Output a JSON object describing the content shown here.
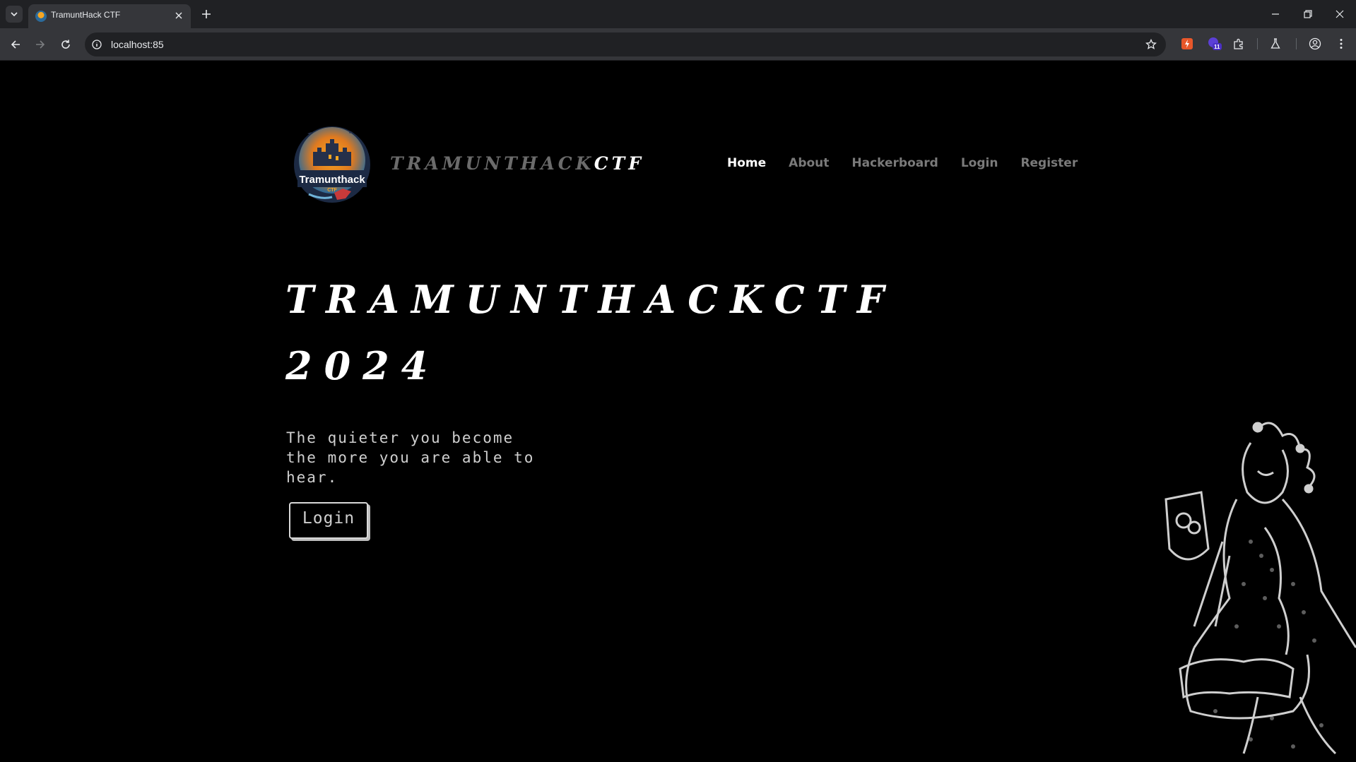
{
  "browser": {
    "tab_title": "TramuntHack CTF",
    "url": "localhost:85",
    "extension_badge": "11"
  },
  "site": {
    "brand_prefix": "TRAMUNTHACK",
    "brand_suffix": "CTF",
    "logo_text": "Tramunthack",
    "logo_subtext": "CTF",
    "nav": [
      {
        "label": "Home",
        "active": true
      },
      {
        "label": "About",
        "active": false
      },
      {
        "label": "Hackerboard",
        "active": false
      },
      {
        "label": "Login",
        "active": false
      },
      {
        "label": "Register",
        "active": false
      }
    ]
  },
  "hero": {
    "title": "TRAMUNTHACKCTF 2024",
    "tagline": "The quieter you become the more you are able to hear.",
    "login_button": "Login"
  },
  "colors": {
    "background": "#000000",
    "nav_active": "#ffffff",
    "nav_inactive": "#7a7a7a",
    "logo_orange": "#f6a623",
    "logo_blue": "#2b6a9a"
  }
}
